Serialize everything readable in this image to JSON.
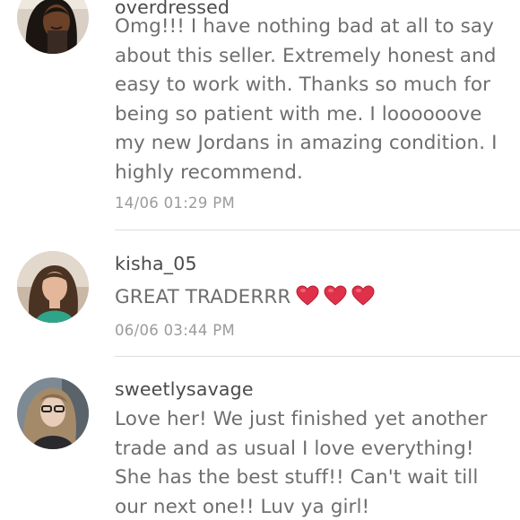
{
  "comments": [
    {
      "username": "overdressed",
      "avatar_icon": "user-avatar-1",
      "lines": [
        "Omg!!! I have nothing bad at all to say",
        "about this seller. Extremely honest and",
        "easy to work with. Thanks so much for",
        "being so patient with me. I loooooove",
        "my new Jordans in amazing condition. I",
        "highly recommend."
      ],
      "timestamp": "14/06 01:29 PM"
    },
    {
      "username": "kisha_05",
      "avatar_icon": "user-avatar-2",
      "lines": [
        "GREAT TRADERRR"
      ],
      "emoji": [
        "red-heart-icon",
        "red-heart-icon",
        "red-heart-icon"
      ],
      "timestamp": "06/06 03:44 PM"
    },
    {
      "username": "sweetlysavage",
      "avatar_icon": "user-avatar-3",
      "lines": [
        "Love her! We just finished yet another",
        "trade and as usual I love everything!",
        "She has the best stuff!! Can't wait till",
        "our next one!! Luv ya girl!"
      ]
    }
  ],
  "colors": {
    "username": "#4a4a4a",
    "body": "#6e6e6e",
    "timestamp": "#9b9b9b",
    "divider": "#dddddd",
    "heart": "#e0314a"
  }
}
